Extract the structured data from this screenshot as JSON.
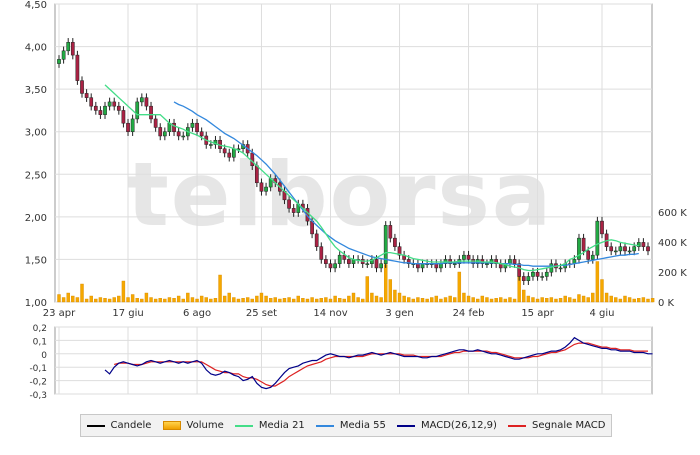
{
  "watermark": "telborsa",
  "legend": [
    {
      "label": "Candele",
      "color": "#000000",
      "kind": "line"
    },
    {
      "label": "Volume",
      "color": "#f5a800",
      "kind": "bar"
    },
    {
      "label": "Media 21",
      "color": "#44dd88",
      "kind": "line"
    },
    {
      "label": "Media 55",
      "color": "#3388dd",
      "kind": "line"
    },
    {
      "label": "MACD(26,12,9)",
      "color": "#000088",
      "kind": "line"
    },
    {
      "label": "Segnale MACD",
      "color": "#dd2222",
      "kind": "line"
    }
  ],
  "chart_data": [
    {
      "type": "candlestick",
      "name": "price",
      "x_tick_labels": [
        "23 apr",
        "17 giu",
        "6 ago",
        "25 set",
        "14 nov",
        "3 gen",
        "24 feb",
        "15 apr",
        "4 giu"
      ],
      "y_tick_labels": [
        "4,50",
        "4,00",
        "3,50",
        "3,00",
        "2,50",
        "2,00",
        "1,50",
        "1,00"
      ],
      "ylim": [
        1.0,
        4.5
      ],
      "grid": true,
      "close_series": [
        3.85,
        3.95,
        4.05,
        3.9,
        3.6,
        3.45,
        3.4,
        3.3,
        3.25,
        3.2,
        3.3,
        3.35,
        3.3,
        3.25,
        3.1,
        3.0,
        3.15,
        3.35,
        3.4,
        3.3,
        3.15,
        3.05,
        2.95,
        3.0,
        3.1,
        3.0,
        2.95,
        2.95,
        3.05,
        3.1,
        3.0,
        2.95,
        2.85,
        2.85,
        2.9,
        2.8,
        2.75,
        2.7,
        2.8,
        2.8,
        2.85,
        2.75,
        2.6,
        2.4,
        2.3,
        2.35,
        2.45,
        2.4,
        2.3,
        2.2,
        2.1,
        2.05,
        2.15,
        2.1,
        1.95,
        1.8,
        1.65,
        1.5,
        1.45,
        1.4,
        1.45,
        1.55,
        1.5,
        1.45,
        1.5,
        1.5,
        1.45,
        1.45,
        1.5,
        1.4,
        1.45,
        1.9,
        1.75,
        1.65,
        1.55,
        1.5,
        1.45,
        1.45,
        1.4,
        1.45,
        1.45,
        1.45,
        1.4,
        1.45,
        1.5,
        1.45,
        1.45,
        1.5,
        1.55,
        1.5,
        1.45,
        1.5,
        1.45,
        1.45,
        1.5,
        1.45,
        1.4,
        1.45,
        1.5,
        1.45,
        1.3,
        1.25,
        1.3,
        1.35,
        1.3,
        1.3,
        1.35,
        1.45,
        1.4,
        1.4,
        1.45,
        1.45,
        1.5,
        1.75,
        1.6,
        1.5,
        1.55,
        1.95,
        1.8,
        1.65,
        1.6,
        1.6,
        1.65,
        1.6,
        1.6,
        1.65,
        1.7,
        1.65,
        1.6
      ],
      "x_range": [
        "23 apr",
        "end"
      ]
    },
    {
      "type": "line",
      "name": "moving-averages",
      "series": [
        {
          "name": "Media 21",
          "color": "#44dd88",
          "values": [
            null,
            null,
            null,
            null,
            null,
            null,
            null,
            null,
            null,
            null,
            3.55,
            3.5,
            3.45,
            3.4,
            3.35,
            3.3,
            3.25,
            3.2,
            3.2,
            3.2,
            3.2,
            3.2,
            3.2,
            3.15,
            3.1,
            3.07,
            3.05,
            3.03,
            3.0,
            2.98,
            2.96,
            2.93,
            2.9,
            2.88,
            2.86,
            2.84,
            2.83,
            2.82,
            2.8,
            2.78,
            2.75,
            2.7,
            2.65,
            2.6,
            2.55,
            2.5,
            2.45,
            2.4,
            2.35,
            2.3,
            2.25,
            2.2,
            2.15,
            2.1,
            2.05,
            2.0,
            1.95,
            1.88,
            1.8,
            1.72,
            1.65,
            1.6,
            1.56,
            1.52,
            1.5,
            1.49,
            1.48,
            1.48,
            1.49,
            1.52,
            1.55,
            1.58,
            1.58,
            1.57,
            1.56,
            1.55,
            1.53,
            1.51,
            1.5,
            1.49,
            1.48,
            1.47,
            1.47,
            1.47,
            1.47,
            1.47,
            1.47,
            1.48,
            1.48,
            1.48,
            1.48,
            1.48,
            1.47,
            1.47,
            1.47,
            1.46,
            1.45,
            1.44,
            1.42,
            1.41,
            1.4,
            1.38,
            1.37,
            1.37,
            1.38,
            1.39,
            1.4,
            1.41,
            1.42,
            1.43,
            1.45,
            1.5,
            1.52,
            1.55,
            1.58,
            1.62,
            1.65,
            1.68,
            1.7,
            1.72,
            1.73,
            1.72,
            1.7,
            1.69,
            1.68,
            1.67,
            1.66
          ]
        },
        {
          "name": "Media 55",
          "color": "#3388dd",
          "values": [
            null,
            null,
            null,
            null,
            null,
            null,
            null,
            null,
            null,
            null,
            null,
            null,
            null,
            null,
            null,
            null,
            null,
            null,
            null,
            null,
            null,
            null,
            null,
            null,
            null,
            3.35,
            3.32,
            3.3,
            3.27,
            3.24,
            3.2,
            3.17,
            3.14,
            3.1,
            3.06,
            3.02,
            2.98,
            2.95,
            2.92,
            2.88,
            2.84,
            2.8,
            2.76,
            2.72,
            2.67,
            2.62,
            2.56,
            2.5,
            2.43,
            2.36,
            2.29,
            2.22,
            2.15,
            2.08,
            2.01,
            1.95,
            1.9,
            1.85,
            1.8,
            1.76,
            1.72,
            1.69,
            1.66,
            1.63,
            1.61,
            1.59,
            1.57,
            1.55,
            1.53,
            1.52,
            1.51,
            1.5,
            1.49,
            1.48,
            1.47,
            1.46,
            1.46,
            1.45,
            1.45,
            1.45,
            1.45,
            1.45,
            1.45,
            1.45,
            1.46,
            1.46,
            1.46,
            1.46,
            1.46,
            1.46,
            1.46,
            1.46,
            1.46,
            1.46,
            1.46,
            1.46,
            1.45,
            1.45,
            1.45,
            1.44,
            1.44,
            1.43,
            1.43,
            1.42,
            1.42,
            1.42,
            1.42,
            1.42,
            1.42,
            1.43,
            1.43,
            1.44,
            1.45,
            1.46,
            1.47,
            1.48,
            1.49,
            1.5,
            1.51,
            1.52,
            1.53,
            1.54,
            1.55,
            1.55,
            1.56,
            1.56,
            1.57
          ]
        }
      ]
    },
    {
      "type": "bar",
      "name": "volume",
      "y_tick_labels": [
        "600 K",
        "400 K",
        "200 K",
        "0 K"
      ],
      "ylim": [
        0,
        600000
      ],
      "values": [
        50000,
        30000,
        60000,
        40000,
        30000,
        120000,
        20000,
        40000,
        20000,
        30000,
        25000,
        20000,
        30000,
        40000,
        140000,
        30000,
        50000,
        25000,
        20000,
        60000,
        30000,
        20000,
        25000,
        20000,
        30000,
        25000,
        40000,
        20000,
        60000,
        30000,
        20000,
        40000,
        30000,
        20000,
        25000,
        180000,
        40000,
        60000,
        30000,
        20000,
        25000,
        30000,
        20000,
        40000,
        60000,
        40000,
        25000,
        30000,
        20000,
        25000,
        30000,
        20000,
        40000,
        25000,
        20000,
        30000,
        20000,
        25000,
        30000,
        20000,
        40000,
        25000,
        20000,
        40000,
        60000,
        30000,
        20000,
        170000,
        60000,
        40000,
        30000,
        250000,
        150000,
        80000,
        60000,
        40000,
        30000,
        20000,
        30000,
        25000,
        20000,
        30000,
        40000,
        20000,
        30000,
        40000,
        30000,
        200000,
        60000,
        40000,
        30000,
        20000,
        40000,
        30000,
        20000,
        25000,
        30000,
        20000,
        30000,
        20000,
        170000,
        80000,
        40000,
        30000,
        20000,
        30000,
        25000,
        30000,
        20000,
        25000,
        40000,
        30000,
        20000,
        50000,
        40000,
        30000,
        60000,
        270000,
        150000,
        60000,
        40000,
        30000,
        20000,
        40000,
        30000,
        20000,
        25000,
        30000,
        20000,
        25000
      ]
    },
    {
      "type": "line",
      "name": "macd",
      "y_tick_labels": [
        "0,2",
        "0,1",
        "0",
        "-0,1",
        "-0,2",
        "-0,3"
      ],
      "ylim": [
        -0.3,
        0.2
      ],
      "series": [
        {
          "name": "MACD(26,12,9)",
          "color": "#000088",
          "values": [
            null,
            null,
            null,
            null,
            null,
            null,
            null,
            null,
            null,
            null,
            -0.12,
            -0.15,
            -0.1,
            -0.07,
            -0.06,
            -0.07,
            -0.08,
            -0.09,
            -0.08,
            -0.06,
            -0.05,
            -0.06,
            -0.07,
            -0.06,
            -0.05,
            -0.06,
            -0.07,
            -0.06,
            -0.07,
            -0.06,
            -0.05,
            -0.07,
            -0.12,
            -0.15,
            -0.16,
            -0.15,
            -0.13,
            -0.14,
            -0.16,
            -0.17,
            -0.2,
            -0.19,
            -0.17,
            -0.22,
            -0.25,
            -0.26,
            -0.25,
            -0.22,
            -0.18,
            -0.14,
            -0.11,
            -0.1,
            -0.09,
            -0.07,
            -0.06,
            -0.05,
            -0.05,
            -0.03,
            -0.01,
            0.0,
            -0.01,
            -0.02,
            -0.02,
            -0.03,
            -0.02,
            -0.01,
            -0.01,
            0.0,
            0.01,
            0.0,
            -0.01,
            0.0,
            0.01,
            0.0,
            -0.01,
            -0.02,
            -0.02,
            -0.02,
            -0.02,
            -0.03,
            -0.03,
            -0.02,
            -0.02,
            -0.01,
            0.0,
            0.01,
            0.02,
            0.03,
            0.03,
            0.02,
            0.02,
            0.03,
            0.02,
            0.01,
            0.0,
            0.0,
            -0.01,
            -0.02,
            -0.03,
            -0.04,
            -0.04,
            -0.03,
            -0.02,
            -0.01,
            0.0,
            0.0,
            0.01,
            0.02,
            0.02,
            0.03,
            0.05,
            0.08,
            0.12,
            0.1,
            0.08,
            0.07,
            0.06,
            0.05,
            0.04,
            0.04,
            0.03,
            0.03,
            0.02,
            0.02,
            0.02,
            0.01,
            0.01,
            0.01,
            0.0,
            0.0
          ]
        },
        {
          "name": "Segnale MACD",
          "color": "#dd2222",
          "values": [
            null,
            null,
            null,
            null,
            null,
            null,
            null,
            null,
            null,
            null,
            null,
            null,
            -0.08,
            -0.07,
            -0.07,
            -0.07,
            -0.08,
            -0.08,
            -0.08,
            -0.07,
            -0.06,
            -0.06,
            -0.06,
            -0.06,
            -0.06,
            -0.06,
            -0.06,
            -0.06,
            -0.06,
            -0.06,
            -0.06,
            -0.06,
            -0.08,
            -0.1,
            -0.12,
            -0.13,
            -0.14,
            -0.14,
            -0.15,
            -0.15,
            -0.17,
            -0.18,
            -0.18,
            -0.19,
            -0.21,
            -0.23,
            -0.24,
            -0.24,
            -0.22,
            -0.2,
            -0.17,
            -0.15,
            -0.13,
            -0.11,
            -0.09,
            -0.08,
            -0.07,
            -0.06,
            -0.04,
            -0.03,
            -0.02,
            -0.02,
            -0.02,
            -0.02,
            -0.02,
            -0.02,
            -0.02,
            -0.01,
            0.0,
            0.0,
            0.0,
            0.0,
            0.0,
            0.0,
            0.0,
            -0.01,
            -0.01,
            -0.01,
            -0.02,
            -0.02,
            -0.02,
            -0.02,
            -0.02,
            -0.02,
            -0.01,
            0.0,
            0.01,
            0.01,
            0.02,
            0.02,
            0.02,
            0.02,
            0.02,
            0.02,
            0.01,
            0.01,
            0.0,
            -0.01,
            -0.02,
            -0.03,
            -0.03,
            -0.03,
            -0.03,
            -0.02,
            -0.02,
            -0.01,
            0.0,
            0.01,
            0.01,
            0.02,
            0.03,
            0.05,
            0.07,
            0.08,
            0.08,
            0.08,
            0.07,
            0.06,
            0.05,
            0.05,
            0.04,
            0.04,
            0.03,
            0.03,
            0.03,
            0.02,
            0.02,
            0.02,
            0.02
          ]
        }
      ]
    }
  ]
}
